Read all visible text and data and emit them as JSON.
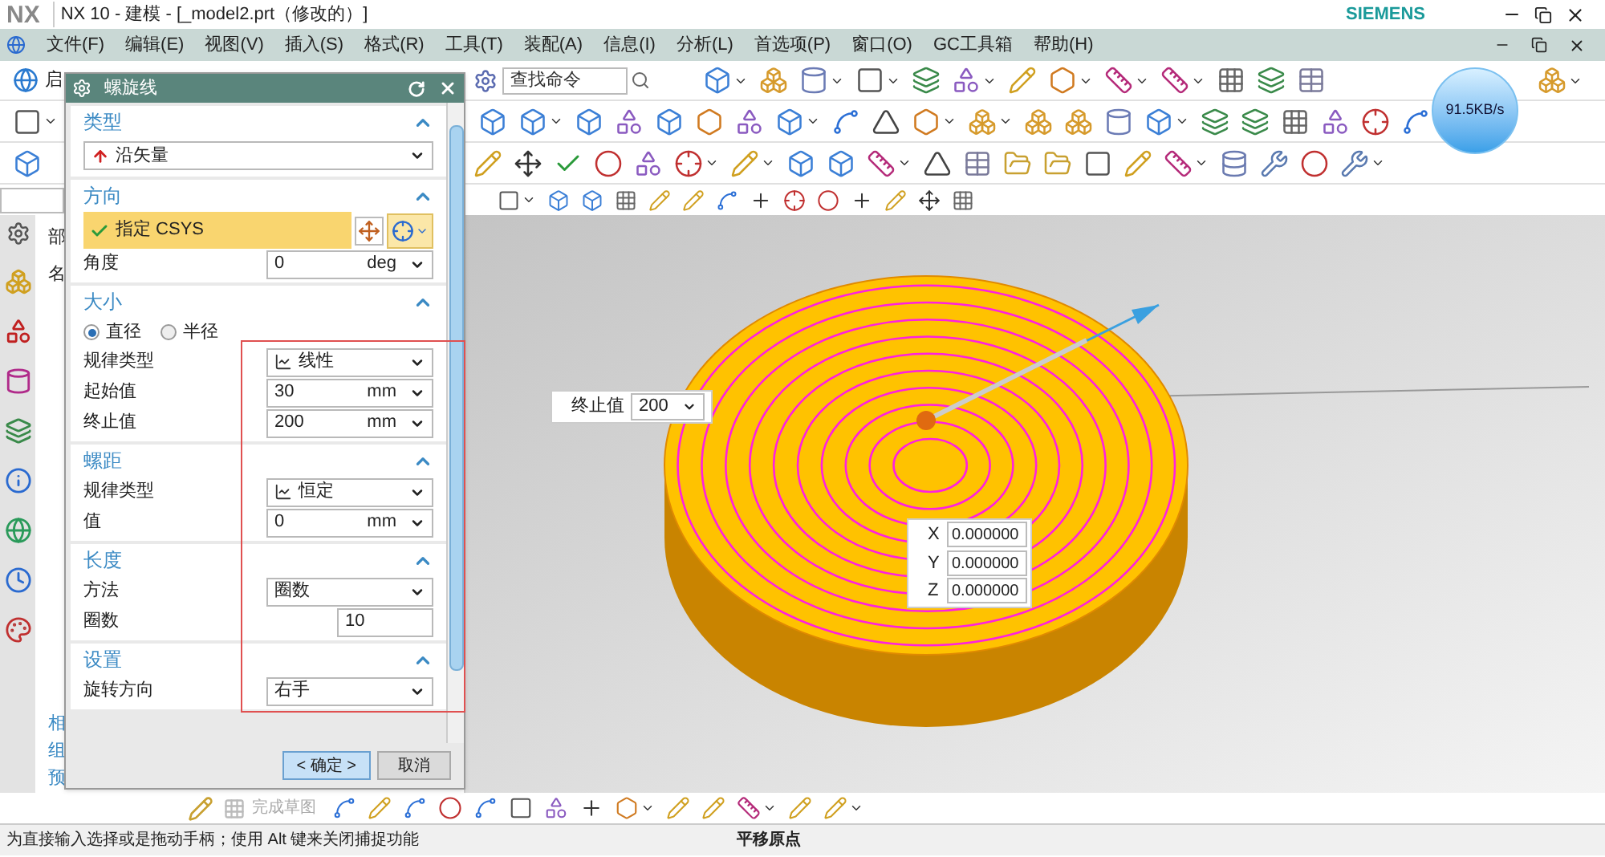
{
  "window": {
    "logo": "NX",
    "title": "NX 10 - 建模 - [_model2.prt（修改的）]",
    "brand": "SIEMENS"
  },
  "menu": [
    {
      "label": "文件(F)"
    },
    {
      "label": "编辑(E)"
    },
    {
      "label": "视图(V)"
    },
    {
      "label": "插入(S)"
    },
    {
      "label": "格式(R)"
    },
    {
      "label": "工具(T)"
    },
    {
      "label": "装配(A)"
    },
    {
      "label": "信息(I)"
    },
    {
      "label": "分析(L)"
    },
    {
      "label": "首选项(P)"
    },
    {
      "label": "窗口(O)"
    },
    {
      "label": "GC工具箱"
    },
    {
      "label": "帮助(H)"
    }
  ],
  "toolbar": {
    "start_label": "启",
    "search_placeholder": "查找命令"
  },
  "speed_badge": "91.5KB/s",
  "navigator": {
    "top_labels": [
      "部",
      "名"
    ],
    "bottom_tabs": [
      "相",
      "组",
      "预"
    ]
  },
  "dialog": {
    "title": "螺旋线",
    "sections": [
      {
        "title": "类型",
        "expanded": true,
        "rows": [
          {
            "kind": "select",
            "value": "沿矢量"
          }
        ]
      },
      {
        "title": "方向",
        "expanded": true,
        "rows": [
          {
            "kind": "csys",
            "value": "指定 CSYS",
            "done": true
          },
          {
            "kind": "value_unit",
            "label": "角度",
            "value": "0",
            "unit": "deg"
          }
        ]
      },
      {
        "title": "大小",
        "expanded": true,
        "rows": [
          {
            "kind": "radio_group",
            "options": [
              {
                "label": "直径",
                "selected": true
              },
              {
                "label": "半径",
                "selected": false
              }
            ]
          },
          {
            "kind": "select",
            "label": "规律类型",
            "value": "线性"
          },
          {
            "kind": "value_unit",
            "label": "起始值",
            "value": "30",
            "unit": "mm"
          },
          {
            "kind": "value_unit",
            "label": "终止值",
            "value": "200",
            "unit": "mm"
          }
        ]
      },
      {
        "title": "螺距",
        "expanded": true,
        "rows": [
          {
            "kind": "select",
            "label": "规律类型",
            "value": "恒定"
          },
          {
            "kind": "value_unit",
            "label": "值",
            "value": "0",
            "unit": "mm"
          }
        ]
      },
      {
        "title": "长度",
        "expanded": true,
        "rows": [
          {
            "kind": "select",
            "label": "方法",
            "value": "圈数"
          },
          {
            "kind": "number",
            "label": "圈数",
            "value": "10"
          }
        ]
      },
      {
        "title": "设置",
        "expanded": true,
        "rows": [
          {
            "kind": "select",
            "label": "旋转方向",
            "value": "右手"
          }
        ]
      }
    ],
    "ok_button": "< 确定 >",
    "cancel_button": "取消"
  },
  "viewport": {
    "end_value": {
      "label": "终止值",
      "value": "200"
    },
    "coords": [
      {
        "axis": "X",
        "value": "0.000000"
      },
      {
        "axis": "Y",
        "value": "0.000000"
      },
      {
        "axis": "Z",
        "value": "0.000000"
      }
    ]
  },
  "sketch_toolbar": {
    "finish_label": "完成草图",
    "disabled": true
  },
  "status_bar": {
    "prompt": "为直接输入选择或是拖动手柄；使用 Alt 键来关闭捕捉功能",
    "action": "平移原点"
  }
}
